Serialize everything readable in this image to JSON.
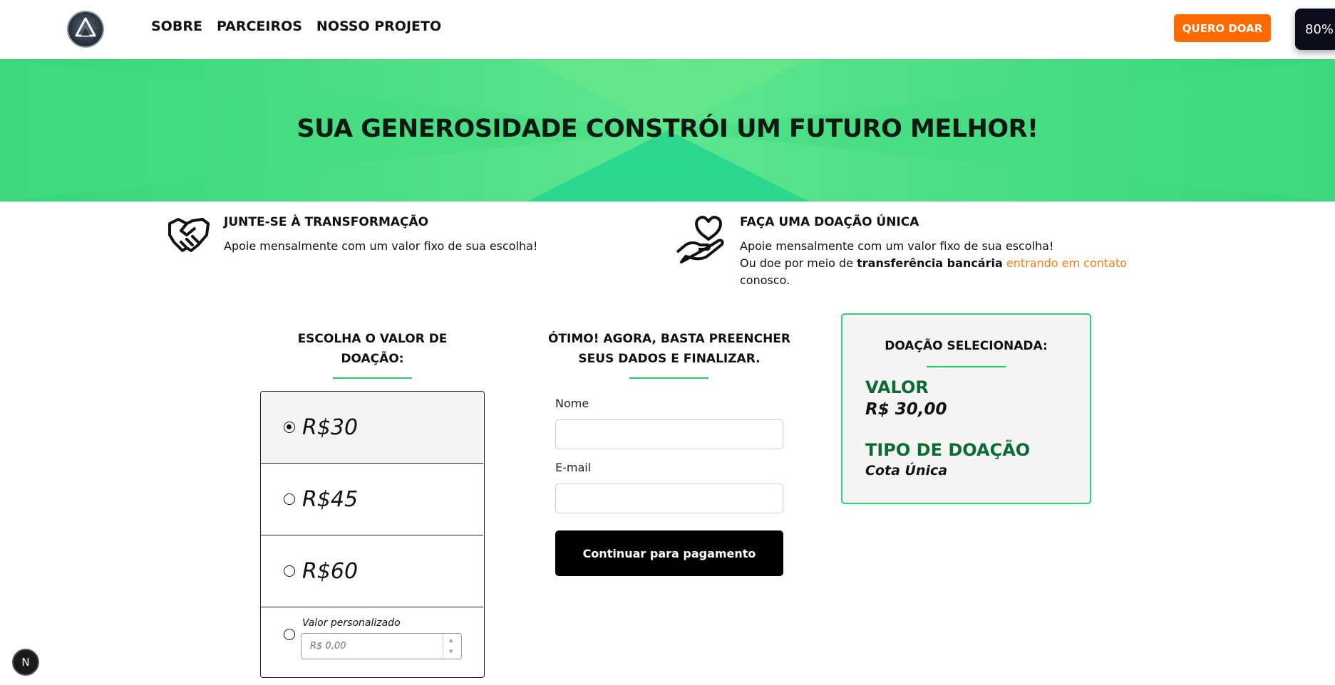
{
  "header": {
    "nav": [
      "SOBRE",
      "PARCEIROS",
      "NOSSO PROJETO"
    ],
    "cta_label": "QUERO DOAR",
    "zoom": "80%"
  },
  "hero": {
    "title": "SUA GENEROSIDADE CONSTRÓI UM FUTURO MELHOR!"
  },
  "info": {
    "monthly": {
      "title": "JUNTE-SE À TRANSFORMAÇÃO",
      "text": "Apoie mensalmente com um valor fixo de sua escolha!"
    },
    "single": {
      "title": "FAÇA UMA DOAÇÃO ÚNICA",
      "text1": "Apoie mensalmente com um valor fixo de sua escolha!",
      "text2_pre": "Ou doe por meio de ",
      "text2_bold": "transferência bancária",
      "text2_link": " entrando em contato",
      "text3": "conosco."
    }
  },
  "amount_section": {
    "title_line1": "ESCOLHA O VALOR DE",
    "title_line2": "DOAÇÃO:",
    "options": [
      "R$30",
      "R$45",
      "R$60"
    ],
    "selected_index": 0,
    "custom_label": "Valor personalizado",
    "custom_placeholder": "R$ 0,00"
  },
  "form_section": {
    "title_line1": "ÓTIMO! AGORA, BASTA PREENCHER",
    "title_line2": "SEUS DADOS E FINALIZAR.",
    "name_label": "Nome",
    "email_label": "E-mail",
    "submit_label": "Continuar para pagamento"
  },
  "summary": {
    "title": "DOAÇÃO SELECIONADA:",
    "value_label": "VALOR",
    "value": "R$ 30,00",
    "type_label": "TIPO DE DOAÇÃO",
    "type": "Cota Única"
  },
  "dev_badge": "N",
  "colors": {
    "accent": "#ff6a00",
    "hero_green": "#36d57a",
    "summary_label": "#0b6b33",
    "link": "#ff7a0a"
  }
}
